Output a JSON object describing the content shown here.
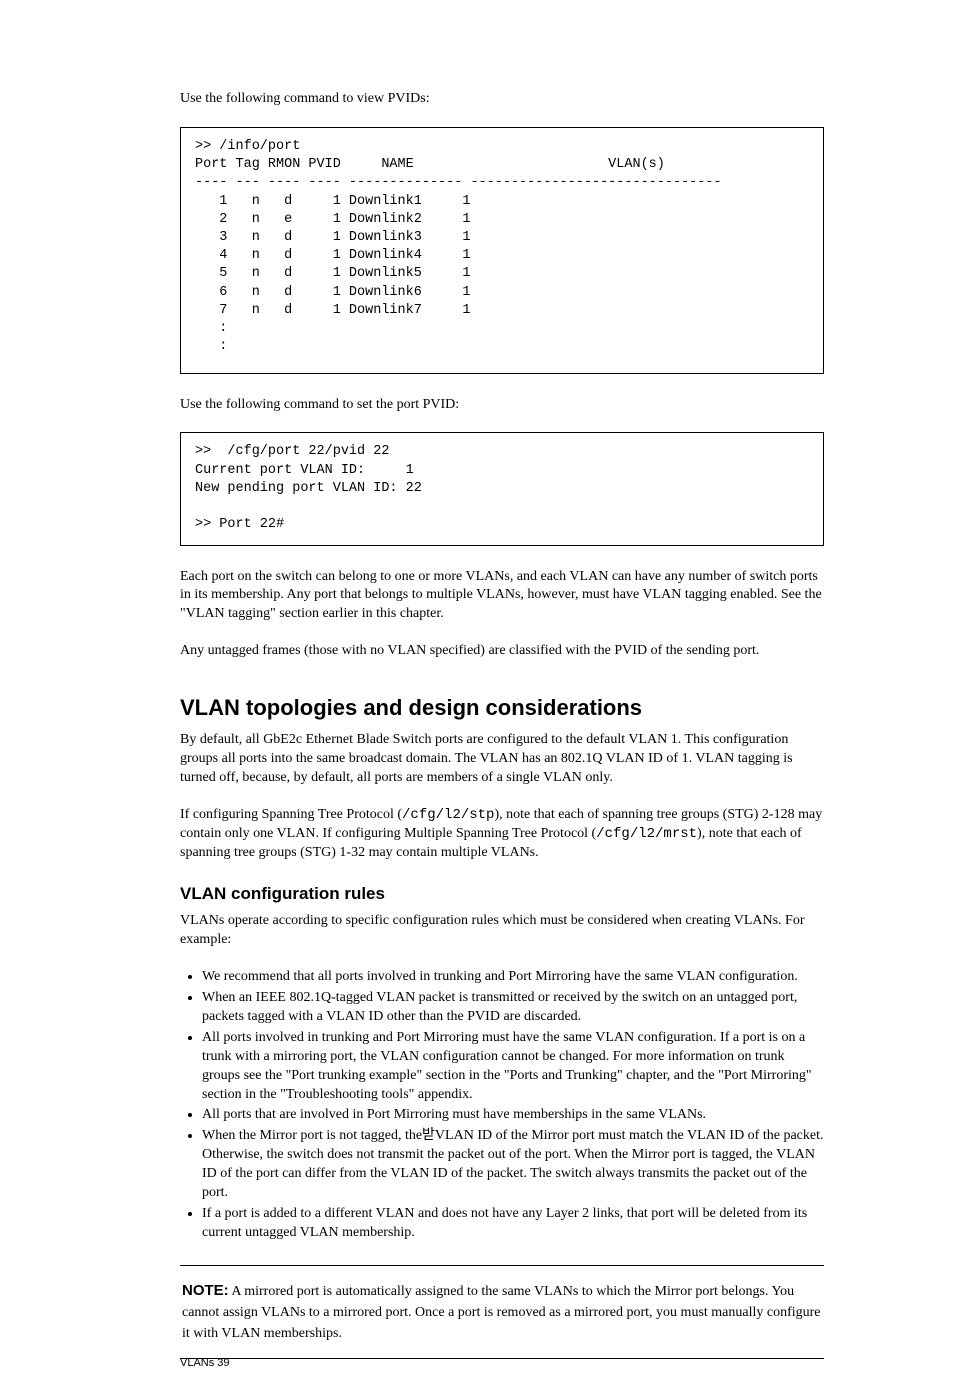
{
  "p_intro_1": "Use the following command to view PVIDs:",
  "code_block_1": ">> /info/port\nPort Tag RMON PVID     NAME                        VLAN(s)\n---- --- ---- ---- -------------- -------------------------------\n   1   n   d     1 Downlink1     1\n   2   n   e     1 Downlink2     1\n   3   n   d     1 Downlink3     1\n   4   n   d     1 Downlink4     1\n   5   n   d     1 Downlink5     1\n   6   n   d     1 Downlink6     1\n   7   n   d     1 Downlink7     1\n   :\n   :",
  "p_intro_2": "Use the following command to set the port PVID:",
  "code_block_2": ">>  /cfg/port 22/pvid 22\nCurrent port VLAN ID:     1\nNew pending port VLAN ID: 22\n\n>> Port 22#",
  "p_after_code": "Each port on the switch can belong to one or more VLANs, and each VLAN can have any number of switch ports in its membership. Any port that belongs to multiple VLANs, however, must have VLAN tagging enabled. See the \"VLAN tagging\" section earlier in this chapter.",
  "p_default_vlan": "Any untagged frames (those with no VLAN specified) are classified with the PVID of the sending port.",
  "section_topology": "VLAN topologies and design considerations",
  "p_topology": "By default, all GbE2c Ethernet Blade Switch ports are configured to the default VLAN 1. This configuration groups all ports into the same broadcast domain. The VLAN has an 802.1Q VLAN ID of 1. VLAN tagging is turned off, because, by default, all ports are members of a single VLAN only.",
  "p_stg_heading": "If configuring Spanning Tree Protocol (",
  "p_stg_cmd": "/cfg/l2/stp",
  "p_stg_tail": "), note that each of spanning tree groups (STG) 2-128 may contain only one VLAN. ",
  "p_mstp_heading": "If configuring Multiple Spanning Tree Protocol (",
  "p_mstp_cmd": "/cfg/l2/mrst",
  "p_mstp_tail": "), note that each of spanning tree groups (STG) 1-32 may contain multiple VLANs.",
  "subsection_cfg": "VLAN configuration rules",
  "p_cfg_intro": "VLANs operate according to specific configuration rules which must be considered when creating VLANs. For example:",
  "bullets1": [
    "We recommend that all ports involved in trunking and Port Mirroring have the same VLAN configuration.",
    "When an IEEE 802.1Q-tagged VLAN packet is transmitted or received by the switch on an untagged port, packets tagged with a VLAN ID other than the PVID are discarded.",
    "All ports involved in trunking and Port Mirroring must have the same VLAN configuration. If a port is on a trunk with a mirroring port, the VLAN configuration cannot be changed. For more information on trunk groups see the \"Port trunking example\" section in the \"Ports and Trunking\" chapter, and the \"Port Mirroring\" section in the \"Troubleshooting tools\" appendix.",
    "All ports that are involved in Port Mirroring must have memberships in the same VLANs.",
    "When the Mirror port is not tagged, the받VLAN ID of the Mirror port must match the VLAN ID of the packet. Otherwise, the switch does not transmit the packet out of the port. When the Mirror port is tagged, the VLAN ID of the port can differ from the VLAN ID of the packet. The switch always transmits the packet out of the port.",
    "If a port is added to a different VLAN and does not have any Layer 2 links, that port will be deleted from its current untagged VLAN membership."
  ],
  "note_label": "NOTE:",
  "note_text": " A mirrored port is automatically assigned to the same VLANs to which the Mirror port belongs. You cannot assign VLANs to a mirrored port. Once a port is removed as a mirrored port, you must manually configure it with VLAN memberships.",
  "footer_left": "VLANs 39",
  "footer_right": ""
}
